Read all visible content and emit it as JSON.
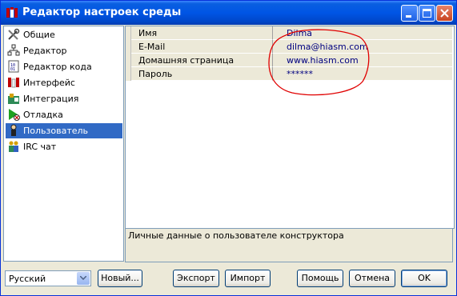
{
  "window": {
    "title": "Редактор настроек среды"
  },
  "sidebar": {
    "items": [
      {
        "label": "Общие",
        "icon": "tools-icon"
      },
      {
        "label": "Редактор",
        "icon": "editor-icon"
      },
      {
        "label": "Редактор кода",
        "icon": "code-editor-icon"
      },
      {
        "label": "Интерфейс",
        "icon": "interface-icon"
      },
      {
        "label": "Интеграция",
        "icon": "integration-icon"
      },
      {
        "label": "Отладка",
        "icon": "debug-icon"
      },
      {
        "label": "Пользователь",
        "icon": "user-icon",
        "selected": true
      },
      {
        "label": "IRC чат",
        "icon": "irc-chat-icon"
      }
    ]
  },
  "properties": [
    {
      "name": "Имя",
      "value": "Dilma"
    },
    {
      "name": "E-Mail",
      "value": "dilma@hiasm.com"
    },
    {
      "name": "Домашняя страница",
      "value": "www.hiasm.com"
    },
    {
      "name": "Пароль",
      "value": "******"
    }
  ],
  "description": "Личные данные о пользователе конструктора",
  "language": {
    "selected": "Русский"
  },
  "buttons": {
    "new": "Новый...",
    "export": "Экспорт",
    "import": "Импорт",
    "help": "Помощь",
    "cancel": "Отмена",
    "ok": "OK"
  },
  "colors": {
    "selection": "#316ac5",
    "annotation": "#e00000",
    "value_text": "#000080"
  }
}
